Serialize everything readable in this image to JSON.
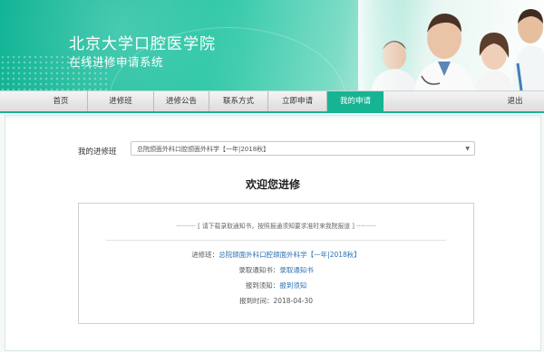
{
  "header": {
    "title": "北京大学口腔医学院",
    "subtitle": "在线进修申请系统"
  },
  "nav": {
    "items": [
      {
        "label": "首页"
      },
      {
        "label": "进修班"
      },
      {
        "label": "进修公告"
      },
      {
        "label": "联系方式"
      },
      {
        "label": "立即申请"
      },
      {
        "label": "我的申请"
      },
      {
        "label": "退出"
      }
    ],
    "active_index": 5
  },
  "main": {
    "course_label": "我的进修班",
    "course_selected": "总院颌面外科口腔颌面外科学【一年|2018秋】",
    "welcome": "欢迎您进修",
    "notice": "·········· [ 请下载录取通知书，按照报通须知要求准时来我院报道 ] ··········",
    "rows": {
      "course_key": "进修班：",
      "course_value": "总院颌面外科口腔颌面外科学【一年|2018秋】",
      "admission_key": "录取通知书：",
      "admission_value": "录取通知书",
      "report_key": "报到须知：",
      "report_value": "报到须知",
      "date_key": "报到时间：",
      "date_value": "2018-04-30"
    }
  },
  "colors": {
    "brand": "#17b494",
    "link": "#2a6fb0"
  }
}
